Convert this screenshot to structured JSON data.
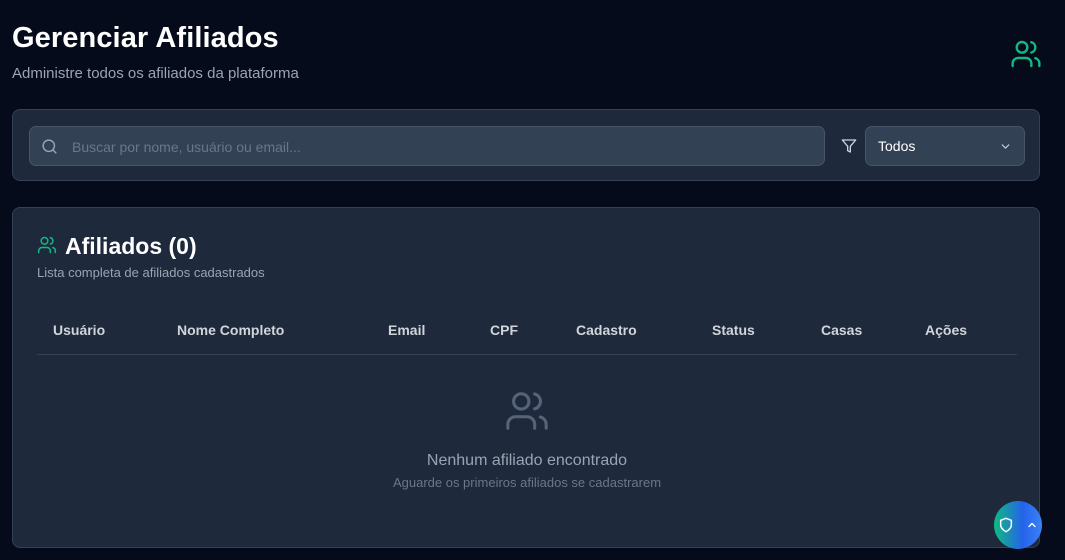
{
  "header": {
    "title": "Gerenciar Afiliados",
    "subtitle": "Administre todos os afiliados da plataforma",
    "icon": "users-icon"
  },
  "filters": {
    "search_placeholder": "Buscar por nome, usuário ou email...",
    "search_value": "",
    "status_selected": "Todos",
    "icons": [
      "search-icon",
      "filter-icon",
      "chevron-down-icon"
    ]
  },
  "list": {
    "title": "Afiliados (0)",
    "subtitle": "Lista completa de afiliados cadastrados",
    "columns": [
      "Usuário",
      "Nome Completo",
      "Email",
      "CPF",
      "Cadastro",
      "Status",
      "Casas",
      "Ações"
    ],
    "rows": [],
    "empty_title": "Nenhum afiliado encontrado",
    "empty_subtitle": "Aguarde os primeiros afiliados se cadastrarem"
  },
  "floating": {
    "icons": [
      "shield-icon",
      "chevron-up-icon"
    ]
  },
  "colors": {
    "background": "#050b1a",
    "card": "#1e293b",
    "accent": "#10b981",
    "muted_text": "#9aa4b2"
  }
}
